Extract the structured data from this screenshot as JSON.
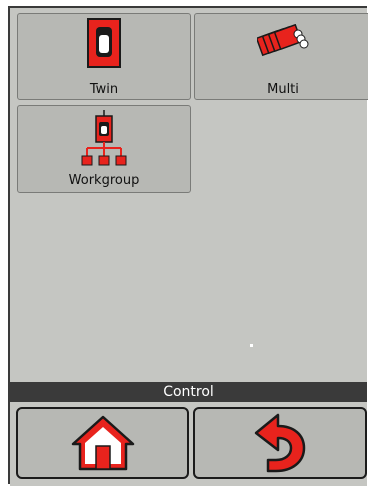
{
  "apps": {
    "twin": {
      "label": "Twin",
      "icon": "handset-icon"
    },
    "multi": {
      "label": "Multi",
      "icon": "stacked-handsets-icon"
    },
    "workgroup": {
      "label": "Workgroup",
      "icon": "workgroup-tree-icon"
    }
  },
  "control_bar": {
    "title": "Control"
  },
  "nav": {
    "home_icon": "home-icon",
    "back_icon": "back-arrow-icon"
  },
  "colors": {
    "accent_red": "#e8231d",
    "panel": "#c5c6c2",
    "tile": "#b7b8b4",
    "bar": "#3a3a3a"
  }
}
